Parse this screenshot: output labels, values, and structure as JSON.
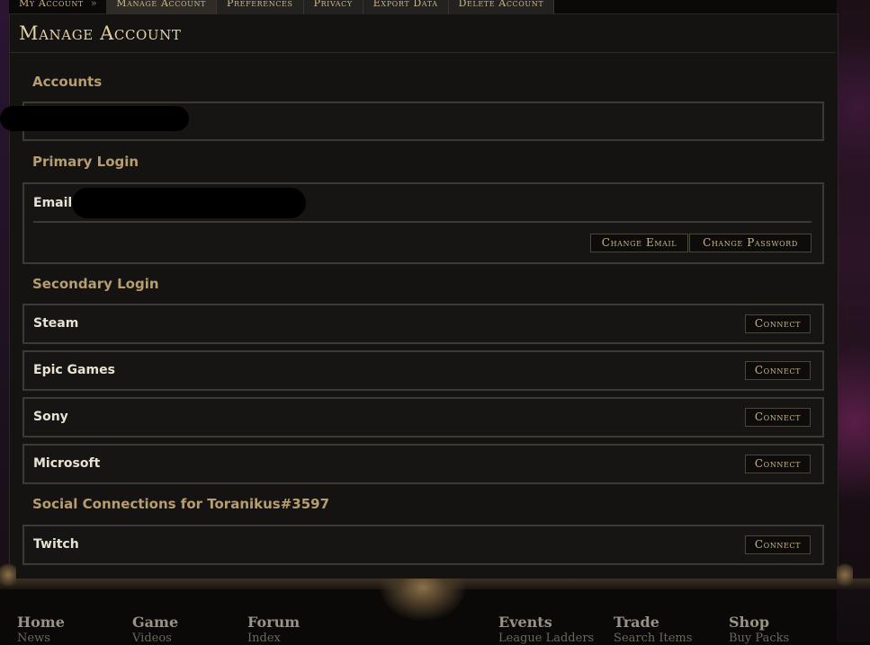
{
  "nav": {
    "breadcrumb": "My Account",
    "breadcrumb_sep": "»",
    "tabs": [
      "Manage Account",
      "Preferences",
      "Privacy",
      "Export Data",
      "Delete Account"
    ]
  },
  "page_title": "Manage Account",
  "accounts": {
    "heading": "Accounts"
  },
  "primary_login": {
    "heading": "Primary Login",
    "email_label": "Email",
    "change_email": "Change Email",
    "change_password": "Change Password"
  },
  "secondary_login": {
    "heading": "Secondary Login",
    "connect_label": "Connect",
    "providers": [
      "Steam",
      "Epic Games",
      "Sony",
      "Microsoft"
    ]
  },
  "social": {
    "heading": "Social Connections for Toranikus#3597",
    "providers": [
      "Twitch"
    ]
  },
  "footer": {
    "columns": [
      {
        "title": "Home",
        "sub": "News"
      },
      {
        "title": "Game",
        "sub": "Videos"
      },
      {
        "title": "Forum",
        "sub": "Index"
      },
      {
        "title": "Events",
        "sub": "League Ladders"
      },
      {
        "title": "Trade",
        "sub": "Search Items"
      },
      {
        "title": "Shop",
        "sub": "Buy Packs"
      }
    ]
  }
}
